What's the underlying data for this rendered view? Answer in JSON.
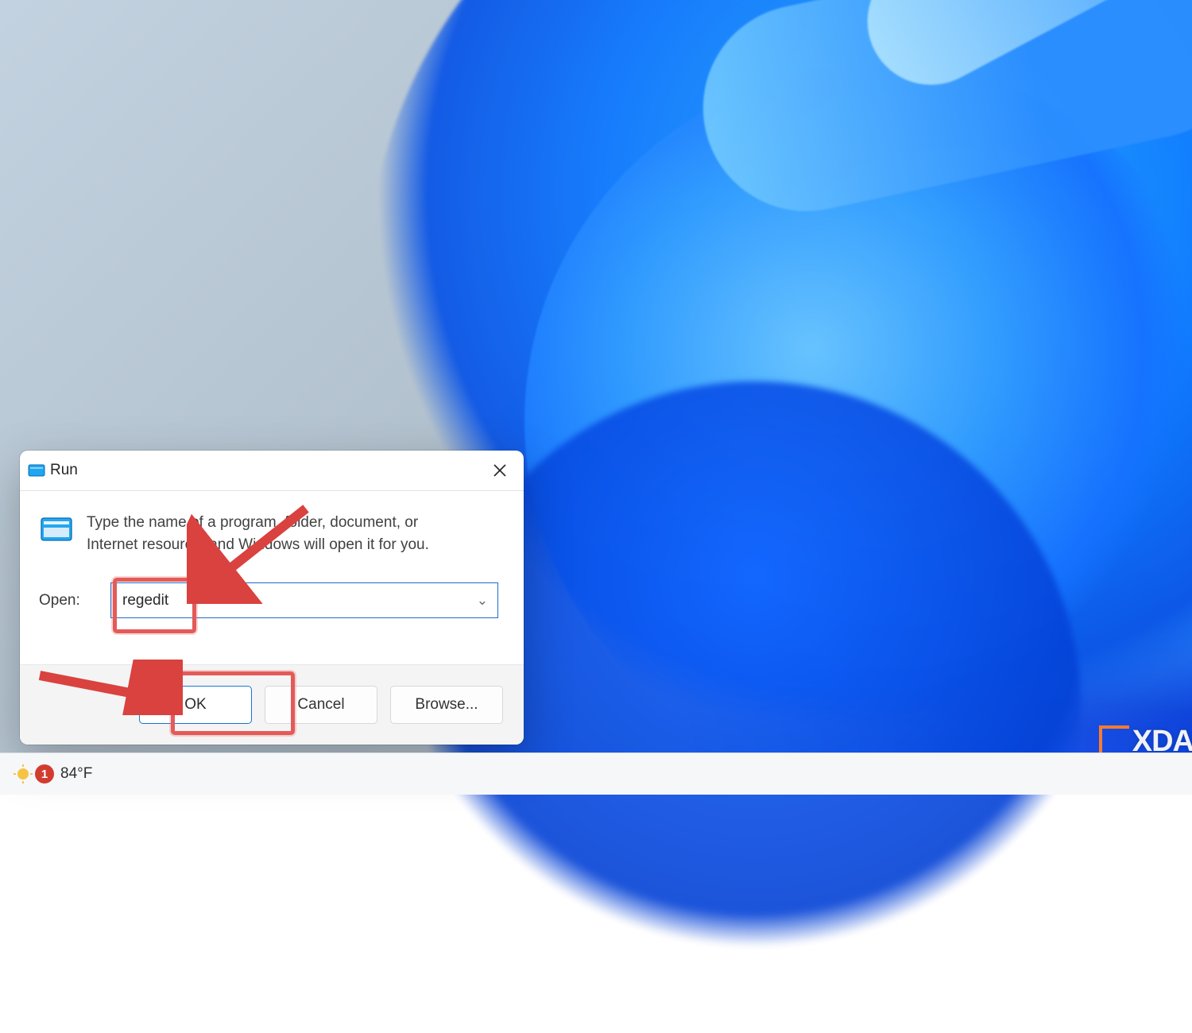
{
  "dialog": {
    "title": "Run",
    "hint": "Type the name of a program, folder, document, or Internet resource, and Windows will open it for you.",
    "open_label": "Open:",
    "input_value": "regedit",
    "buttons": {
      "ok": "OK",
      "cancel": "Cancel",
      "browse": "Browse..."
    }
  },
  "taskbar": {
    "weather_badge": "1",
    "weather_temp": "84°F"
  },
  "watermark": {
    "text": "XDA"
  }
}
